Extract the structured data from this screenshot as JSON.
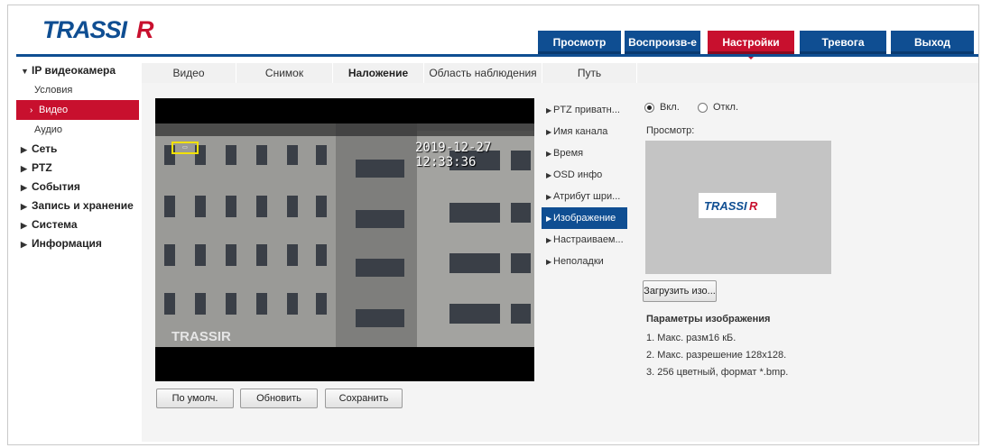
{
  "brand": {
    "logo_text": "TRASSIR",
    "accent_color": "#c8102e",
    "nav_color": "#0f4e92"
  },
  "top_nav": [
    {
      "label": "Просмотр",
      "active": false
    },
    {
      "label": "Воспроизв-е",
      "active": false
    },
    {
      "label": "Настройки",
      "active": true
    },
    {
      "label": "Тревога",
      "active": false
    },
    {
      "label": "Выход",
      "active": false
    }
  ],
  "sidebar": {
    "groups": [
      {
        "label": "IP видеокамера",
        "expanded": true,
        "items": [
          {
            "label": "Условия",
            "active": false
          },
          {
            "label": "Видео",
            "active": true
          },
          {
            "label": "Аудио",
            "active": false
          }
        ]
      },
      {
        "label": "Сеть",
        "expanded": false
      },
      {
        "label": "PTZ",
        "expanded": false
      },
      {
        "label": "События",
        "expanded": false
      },
      {
        "label": "Запись и хранение",
        "expanded": false
      },
      {
        "label": "Система",
        "expanded": false
      },
      {
        "label": "Информация",
        "expanded": false
      }
    ]
  },
  "tabs": [
    {
      "label": "Видео",
      "active": false
    },
    {
      "label": "Снимок",
      "active": false
    },
    {
      "label": "Наложение",
      "active": true
    },
    {
      "label": "Область наблюдения",
      "active": false
    },
    {
      "label": "Путь",
      "active": false
    }
  ],
  "video": {
    "osd_timestamp": "2019-12-27 12:33:36",
    "osd_brand": "TRASSIR"
  },
  "buttons": {
    "default_label": "По умолч.",
    "refresh_label": "Обновить",
    "save_label": "Сохранить",
    "upload_label": "Загрузить изо..."
  },
  "submenu": [
    {
      "label": "PTZ приватн...",
      "active": false
    },
    {
      "label": "Имя канала",
      "active": false
    },
    {
      "label": "Время",
      "active": false
    },
    {
      "label": "OSD инфо",
      "active": false
    },
    {
      "label": "Атрибут шри...",
      "active": false
    },
    {
      "label": "Изображение",
      "active": true
    },
    {
      "label": "Настраиваем...",
      "active": false
    },
    {
      "label": "Неполадки",
      "active": false
    }
  ],
  "overlay_settings": {
    "on_label": "Вкл.",
    "off_label": "Откл.",
    "selected": "on",
    "preview_label": "Просмотр:",
    "params_title": "Параметры изображения",
    "params": [
      "1. Макс. разм16 кБ.",
      "2. Макс. разрешение 128x128.",
      "3. 256 цветный, формат *.bmp."
    ]
  }
}
